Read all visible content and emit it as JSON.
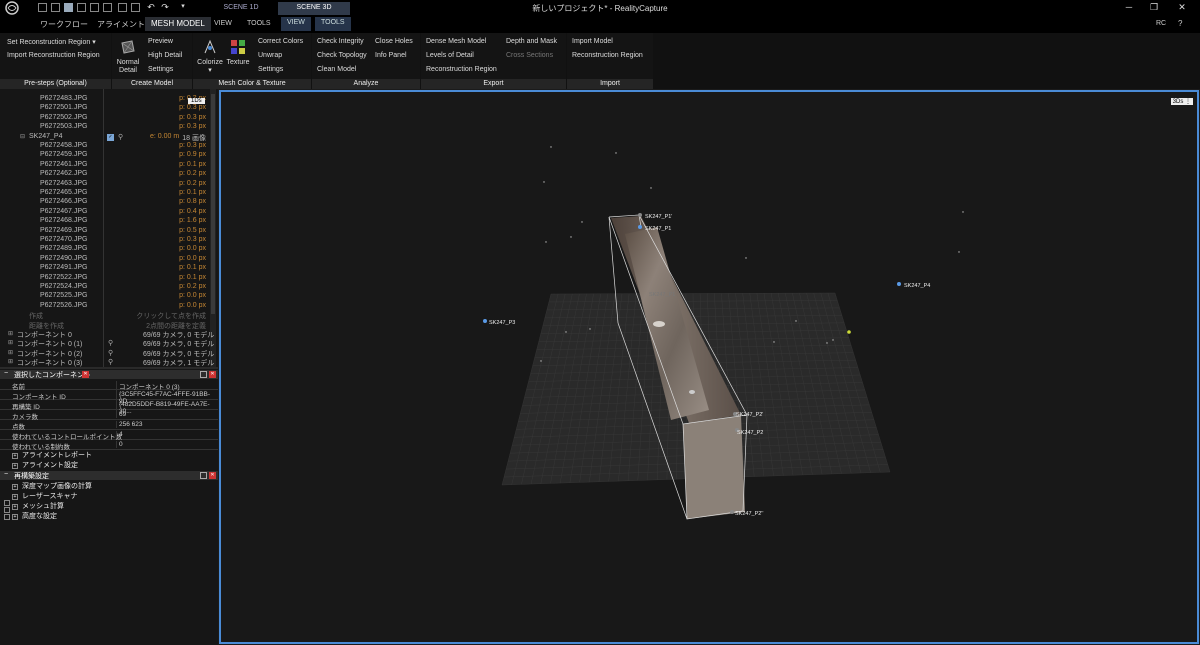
{
  "window": {
    "title": "新しいプロジェクト* - RealityCapture",
    "rc_badge": "RC"
  },
  "scene_tabs": [
    "SCENE 1D",
    "SCENE 3D"
  ],
  "menus": [
    "ワークフロー",
    "アライメント",
    "MESH MODEL",
    "VIEW",
    "TOOLS",
    "VIEW",
    "TOOLS"
  ],
  "ribbon": {
    "pre_steps": {
      "items": [
        "Set Reconstruction Region",
        "Import Reconstruction Region"
      ],
      "label": "Pre-steps (Optional)"
    },
    "create_model": {
      "normal_detail": "Normal Detail",
      "preview": "Preview",
      "high_detail": "High Detail",
      "settings": "Settings",
      "label": "Create Model"
    },
    "mesh_color": {
      "colorize": "Colorize",
      "texture": "Texture",
      "correct_colors": "Correct Colors",
      "unwrap": "Unwrap",
      "settings": "Settings",
      "label": "Mesh Color & Texture"
    },
    "analyze": {
      "check_integrity": "Check Integrity",
      "check_topology": "Check Topology",
      "clean_model": "Clean Model",
      "close_holes": "Close Holes",
      "info_panel": "Info Panel",
      "label": "Analyze"
    },
    "export": {
      "dense_mesh": "Dense Mesh Model",
      "levels_detail": "Levels of Detail",
      "recon_region": "Reconstruction Region",
      "depth_mask": "Depth and Mask",
      "cross_sections": "Cross Sections",
      "label": "Export"
    },
    "import": {
      "import_model": "Import Model",
      "recon_region": "Reconstruction Region",
      "label": "Import"
    }
  },
  "tree": {
    "badge": "1Ds",
    "rows_top": [
      {
        "name": "P6272483.JPG",
        "val": "p: 0.3 px"
      },
      {
        "name": "P6272501.JPG",
        "val": "p: 0.3 px"
      },
      {
        "name": "P6272502.JPG",
        "val": "p: 0.3 px"
      },
      {
        "name": "P6272503.JPG",
        "val": "p: 0.3 px"
      }
    ],
    "group": {
      "name": "SK247_P4",
      "val": "e: 0.00 m",
      "count": "18 画像"
    },
    "rows": [
      {
        "name": "P6272458.JPG",
        "val": "p: 0.3 px"
      },
      {
        "name": "P6272459.JPG",
        "val": "p: 0.9 px"
      },
      {
        "name": "P6272461.JPG",
        "val": "p: 0.1 px"
      },
      {
        "name": "P6272462.JPG",
        "val": "p: 0.2 px"
      },
      {
        "name": "P6272463.JPG",
        "val": "p: 0.2 px"
      },
      {
        "name": "P6272465.JPG",
        "val": "p: 0.1 px"
      },
      {
        "name": "P6272466.JPG",
        "val": "p: 0.8 px"
      },
      {
        "name": "P6272467.JPG",
        "val": "p: 0.4 px"
      },
      {
        "name": "P6272468.JPG",
        "val": "p: 1.6 px"
      },
      {
        "name": "P6272469.JPG",
        "val": "p: 0.5 px"
      },
      {
        "name": "P6272470.JPG",
        "val": "p: 0.3 px"
      },
      {
        "name": "P6272489.JPG",
        "val": "p: 0.0 px"
      },
      {
        "name": "P6272490.JPG",
        "val": "p: 0.0 px"
      },
      {
        "name": "P6272491.JPG",
        "val": "p: 0.1 px"
      },
      {
        "name": "P6272522.JPG",
        "val": "p: 0.1 px"
      },
      {
        "name": "P6272524.JPG",
        "val": "p: 0.2 px"
      },
      {
        "name": "P6272525.JPG",
        "val": "p: 0.0 px"
      },
      {
        "name": "P6272526.JPG",
        "val": "p: 0.0 px"
      }
    ],
    "create": {
      "name": "作成",
      "val": "クリックして点を作成"
    },
    "distance": {
      "name": "距離を作成",
      "val": "2点間の距離を定義"
    },
    "components": [
      {
        "name": "コンポーネント 0",
        "val": "69/69 カメラ, 0 モデル"
      },
      {
        "name": "コンポーネント 0 (1)",
        "val": "69/69 カメラ, 0 モデル"
      },
      {
        "name": "コンポーネント 0 (2)",
        "val": "69/69 カメラ, 0 モデル"
      },
      {
        "name": "コンポーネント 0 (3)",
        "val": "69/69 カメラ, 1 モデル"
      }
    ]
  },
  "selected_component": {
    "header": "選択したコンポーネント",
    "props": [
      {
        "k": "名前",
        "v": "コンポーネント 0 (3)"
      },
      {
        "k": "コンポーネント ID",
        "v": "{3C5FFC45-F7AC-4FFE-91BB-9D..."
      },
      {
        "k": "再構築 ID",
        "v": "{482D5DDF-B819-49FE-AA7E-30..."
      },
      {
        "k": "カメラ数",
        "v": "69"
      },
      {
        "k": "点数",
        "v": "256 623"
      },
      {
        "k": "使われているコントロールポイント数",
        "v": "4"
      },
      {
        "k": "使われている制約数",
        "v": "0"
      }
    ],
    "sections": [
      "アライメントレポート",
      "アライメント設定"
    ]
  },
  "reconstruction": {
    "header": "再構築設定",
    "sections": [
      "深度マップ画像の計算",
      "レーザースキャナ",
      "メッシュ計算",
      "高度な設定"
    ]
  },
  "viewport": {
    "badge": "3Ds",
    "labels": [
      "SK247_P1'",
      "SK247_P1",
      "SK247_P4",
      "SK247_P3",
      "SK247_P2'",
      "SK247_P2",
      "SK247_P2''",
      "SK247_P1"
    ]
  }
}
